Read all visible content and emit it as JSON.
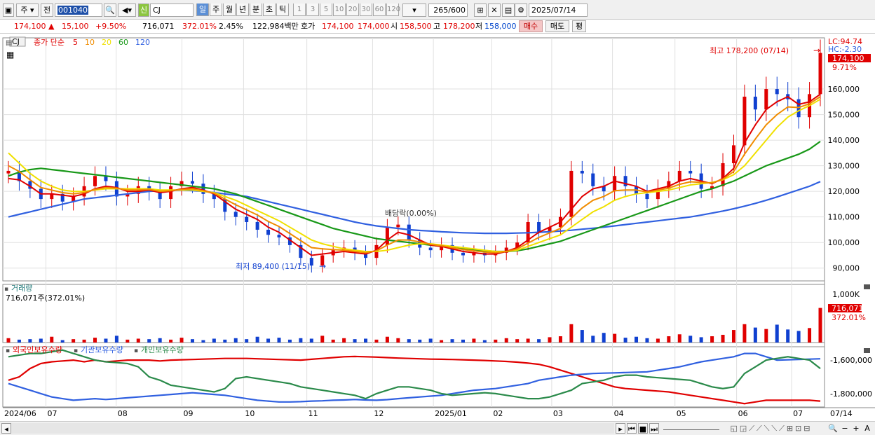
{
  "toolbar": {
    "period_select": "주",
    "prev_label": "전",
    "code": "001040",
    "credit_badge": "신",
    "stock_name": "CJ",
    "period_tabs": [
      "일",
      "주",
      "월",
      "년",
      "분",
      "초",
      "틱"
    ],
    "intervals": [
      "1",
      "3",
      "5",
      "10",
      "20",
      "30",
      "60",
      "120"
    ],
    "count": "265",
    "count_max": "/600",
    "date": "2025/07/14"
  },
  "quote": {
    "price": "174,100",
    "change": "15,100",
    "change_pct": "+9.50%",
    "volume": "716,071",
    "volume_ratio": "372.01%",
    "turnover": "2.45%",
    "amount": "122,984백만",
    "bid_label": "호가",
    "bid1": "174,100",
    "bid2": "174,000",
    "open_label": "시",
    "open": "158,500",
    "high_label": "고",
    "high": "178,200",
    "low_label": "저",
    "low": "158,000",
    "buy": "매수",
    "sell": "매도",
    "eval": "평"
  },
  "colors": {
    "up": "#e00000",
    "down": "#1040d0",
    "ma5": "#e00000",
    "ma10": "#f08c00",
    "ma20": "#f0e000",
    "ma60": "#189818",
    "ma120": "#3060e0",
    "foreign": "#e00000",
    "inst": "#3060e0",
    "indiv": "#2a8a4a"
  },
  "price_panel": {
    "name": "CJ",
    "legend_prefix": "종가 단순",
    "ma_periods": [
      "5",
      "10",
      "20",
      "60",
      "120"
    ],
    "lc": "LC:94.74",
    "hc": "HC:-2.30",
    "last_price": "174,100",
    "last_pct": "9.71%",
    "high_note": "최고 178,200 (07/14)",
    "low_note": "최저 89,400 (11/15)",
    "event_note": "배당락(0.00%)"
  },
  "volume_panel": {
    "title": "거래량",
    "value": "716,071주(372.01%)",
    "last": "716,071",
    "last_pct": "372.01%",
    "scale": "1,000K"
  },
  "holding_panel": {
    "series": [
      "외국인보유수량",
      "기관보유수량",
      "개인보유수량"
    ],
    "scale": [
      "-1,600,000",
      "-1,800,000"
    ]
  },
  "x_axis": {
    "labels": [
      "2024/06",
      "07",
      "08",
      "09",
      "10",
      "11",
      "12",
      "2025/01",
      "02",
      "03",
      "04",
      "05",
      "06",
      "07",
      "07/14"
    ]
  },
  "chart_data": {
    "type": "line",
    "price_axis": {
      "ticks": [
        90000,
        100000,
        110000,
        120000,
        130000,
        140000,
        150000,
        160000
      ],
      "ylim": [
        85000,
        180000
      ]
    },
    "months": [
      "2024/06",
      "07",
      "08",
      "09",
      "10",
      "11",
      "12",
      "2025/01",
      "02",
      "03",
      "04",
      "05",
      "06",
      "07"
    ],
    "close_weekly": [
      128000,
      124000,
      121000,
      117000,
      119000,
      116000,
      118000,
      122000,
      126000,
      124000,
      118000,
      119000,
      122000,
      120000,
      117000,
      122000,
      124000,
      123000,
      119000,
      117000,
      112000,
      110000,
      108000,
      105000,
      103000,
      102000,
      99000,
      94000,
      91000,
      95000,
      97000,
      98000,
      96000,
      94000,
      99000,
      106000,
      107000,
      101000,
      98000,
      97000,
      99000,
      96000,
      95000,
      96000,
      95000,
      96000,
      98000,
      100000,
      108000,
      104000,
      106000,
      110000,
      128000,
      127000,
      122000,
      120000,
      126000,
      122000,
      119000,
      117000,
      121000,
      124000,
      128000,
      127000,
      121000,
      122000,
      131000,
      138000,
      157000,
      152000,
      160000,
      158000,
      156000,
      149000,
      158000,
      174100
    ],
    "ma5": [
      125000,
      124500,
      122000,
      119000,
      119000,
      118500,
      118000,
      119000,
      121000,
      122000,
      121500,
      120000,
      120000,
      120500,
      119500,
      120000,
      121000,
      121500,
      120500,
      119000,
      116000,
      113000,
      111000,
      109000,
      106000,
      104000,
      101000,
      98000,
      95000,
      95500,
      96000,
      96500,
      96000,
      95500,
      97000,
      101000,
      104000,
      103000,
      101000,
      99000,
      98500,
      97500,
      96500,
      96000,
      95500,
      95500,
      96500,
      98000,
      101000,
      104000,
      106000,
      108000,
      113000,
      118000,
      121000,
      122000,
      124000,
      123000,
      122000,
      120000,
      121000,
      122000,
      124000,
      125000,
      124000,
      123000,
      125000,
      129000,
      139000,
      146000,
      152000,
      155000,
      157000,
      154000,
      155000,
      158000
    ],
    "ma20": [
      135000,
      131000,
      127000,
      124000,
      122000,
      120500,
      120000,
      120000,
      120500,
      121000,
      121000,
      121000,
      121000,
      121000,
      120500,
      120500,
      120500,
      120500,
      120000,
      119500,
      118000,
      116500,
      114500,
      112500,
      110500,
      108500,
      106000,
      103500,
      101000,
      99500,
      98500,
      97500,
      97000,
      96500,
      96500,
      97000,
      98000,
      99000,
      99500,
      99500,
      99000,
      98500,
      98000,
      97500,
      97000,
      96500,
      96500,
      97000,
      98500,
      100000,
      101500,
      103000,
      106000,
      109000,
      112000,
      114000,
      116500,
      118000,
      119000,
      119500,
      120000,
      120500,
      121500,
      122500,
      123000,
      123500,
      124500,
      126500,
      130000,
      135000,
      140000,
      145000,
      149000,
      151500,
      153500,
      156000
    ],
    "ma60": [
      126000,
      127500,
      128500,
      129000,
      128500,
      128000,
      127500,
      127000,
      126500,
      126000,
      125500,
      125000,
      124500,
      124000,
      123500,
      123000,
      122500,
      122000,
      121500,
      121000,
      120000,
      119000,
      117500,
      116000,
      114500,
      113000,
      111500,
      110000,
      108500,
      107000,
      105500,
      104500,
      103500,
      102500,
      101500,
      101000,
      100500,
      100000,
      99500,
      99000,
      98500,
      98000,
      97500,
      97000,
      96800,
      96500,
      96500,
      96800,
      97500,
      98500,
      99500,
      100500,
      102000,
      103500,
      105000,
      106500,
      108000,
      109500,
      111000,
      112500,
      114000,
      115500,
      117000,
      118500,
      120000,
      121000,
      122500,
      124000,
      126000,
      128000,
      130000,
      131500,
      133000,
      134500,
      136500,
      139500
    ],
    "ma120": [
      110000,
      111000,
      112000,
      113000,
      114000,
      115000,
      116000,
      117000,
      117500,
      118000,
      118500,
      119000,
      119500,
      120000,
      120200,
      120400,
      120500,
      120300,
      120000,
      119500,
      119000,
      118500,
      118000,
      117000,
      116000,
      115000,
      114000,
      113000,
      112000,
      111000,
      110000,
      109000,
      108000,
      107200,
      106500,
      106000,
      105500,
      105000,
      104700,
      104500,
      104200,
      104000,
      103800,
      103700,
      103600,
      103600,
      103600,
      103700,
      103800,
      104000,
      104200,
      104500,
      104800,
      105200,
      105600,
      106000,
      106500,
      107000,
      107500,
      108000,
      108500,
      109000,
      109500,
      110000,
      110700,
      111500,
      112300,
      113200,
      114200,
      115300,
      116500,
      117800,
      119200,
      120600,
      122000,
      123800
    ],
    "volume_k": [
      90,
      60,
      70,
      80,
      120,
      50,
      70,
      60,
      100,
      80,
      140,
      60,
      80,
      70,
      90,
      60,
      100,
      70,
      50,
      80,
      60,
      90,
      70,
      120,
      80,
      100,
      60,
      90,
      80,
      140,
      60,
      90,
      70,
      80,
      60,
      120,
      90,
      70,
      60,
      80,
      50,
      70,
      60,
      80,
      50,
      60,
      90,
      70,
      80,
      70,
      110,
      130,
      380,
      260,
      140,
      200,
      180,
      100,
      120,
      90,
      80,
      130,
      170,
      140,
      110,
      130,
      160,
      260,
      380,
      310,
      280,
      370,
      270,
      240,
      300,
      716
    ],
    "foreign_holding": [
      -1720000,
      -1700000,
      -1650000,
      -1620000,
      -1610000,
      -1605000,
      -1600000,
      -1610000,
      -1600000,
      -1610000,
      -1605000,
      -1600000,
      -1600000,
      -1600000,
      -1605000,
      -1600000,
      -1598000,
      -1596000,
      -1594000,
      -1592000,
      -1590000,
      -1590000,
      -1590000,
      -1592000,
      -1594000,
      -1596000,
      -1598000,
      -1600000,
      -1595000,
      -1590000,
      -1585000,
      -1580000,
      -1578000,
      -1580000,
      -1582000,
      -1585000,
      -1588000,
      -1590000,
      -1592000,
      -1594000,
      -1595000,
      -1596000,
      -1598000,
      -1600000,
      -1602000,
      -1605000,
      -1608000,
      -1612000,
      -1618000,
      -1625000,
      -1640000,
      -1660000,
      -1680000,
      -1700000,
      -1720000,
      -1740000,
      -1760000,
      -1770000,
      -1775000,
      -1780000,
      -1785000,
      -1790000,
      -1800000,
      -1810000,
      -1820000,
      -1830000,
      -1840000,
      -1850000,
      -1860000,
      -1850000,
      -1840000,
      -1840000,
      -1840000,
      -1840000,
      -1840000,
      -1845000
    ],
    "inst_holding": [
      -1740000,
      -1760000,
      -1780000,
      -1800000,
      -1820000,
      -1830000,
      -1840000,
      -1835000,
      -1830000,
      -1835000,
      -1830000,
      -1825000,
      -1820000,
      -1815000,
      -1810000,
      -1805000,
      -1800000,
      -1795000,
      -1800000,
      -1805000,
      -1810000,
      -1820000,
      -1830000,
      -1840000,
      -1845000,
      -1850000,
      -1850000,
      -1848000,
      -1845000,
      -1843000,
      -1840000,
      -1838000,
      -1835000,
      -1838000,
      -1840000,
      -1836000,
      -1830000,
      -1825000,
      -1820000,
      -1815000,
      -1810000,
      -1800000,
      -1790000,
      -1780000,
      -1775000,
      -1770000,
      -1760000,
      -1750000,
      -1740000,
      -1720000,
      -1710000,
      -1700000,
      -1690000,
      -1685000,
      -1680000,
      -1678000,
      -1676000,
      -1674000,
      -1672000,
      -1670000,
      -1660000,
      -1650000,
      -1640000,
      -1625000,
      -1610000,
      -1600000,
      -1590000,
      -1580000,
      -1560000,
      -1560000,
      -1580000,
      -1600000,
      -1598000,
      -1596000,
      -1594000,
      -1592000
    ],
    "indiv_holding": [
      -1580000,
      -1570000,
      -1560000,
      -1560000,
      -1550000,
      -1540000,
      -1560000,
      -1580000,
      -1600000,
      -1610000,
      -1615000,
      -1620000,
      -1640000,
      -1700000,
      -1720000,
      -1750000,
      -1760000,
      -1770000,
      -1780000,
      -1790000,
      -1770000,
      -1710000,
      -1700000,
      -1710000,
      -1720000,
      -1730000,
      -1740000,
      -1760000,
      -1770000,
      -1780000,
      -1790000,
      -1800000,
      -1810000,
      -1830000,
      -1800000,
      -1780000,
      -1760000,
      -1760000,
      -1770000,
      -1780000,
      -1800000,
      -1810000,
      -1805000,
      -1800000,
      -1795000,
      -1800000,
      -1810000,
      -1820000,
      -1830000,
      -1830000,
      -1820000,
      -1800000,
      -1780000,
      -1740000,
      -1730000,
      -1720000,
      -1700000,
      -1690000,
      -1690000,
      -1700000,
      -1705000,
      -1710000,
      -1715000,
      -1720000,
      -1740000,
      -1760000,
      -1770000,
      -1760000,
      -1680000,
      -1640000,
      -1600000,
      -1590000,
      -1580000,
      -1590000,
      -1600000,
      -1650000
    ]
  }
}
